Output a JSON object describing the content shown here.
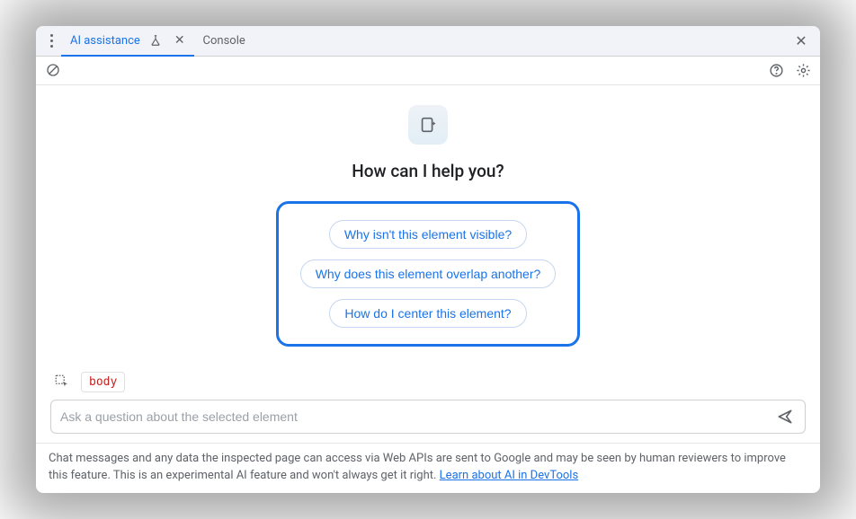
{
  "tabs": {
    "active": "AI assistance",
    "inactive": "Console"
  },
  "heading": "How can I help you?",
  "suggestions": [
    "Why isn't this element visible?",
    "Why does this element overlap another?",
    "How do I center this element?"
  ],
  "context": {
    "selected_element": "body"
  },
  "input": {
    "placeholder": "Ask a question about the selected element"
  },
  "footer": {
    "text": "Chat messages and any data the inspected page can access via Web APIs are sent to Google and may be seen by human reviewers to improve this feature. This is an experimental AI feature and won't always get it right. ",
    "link_text": "Learn about AI in DevTools"
  }
}
